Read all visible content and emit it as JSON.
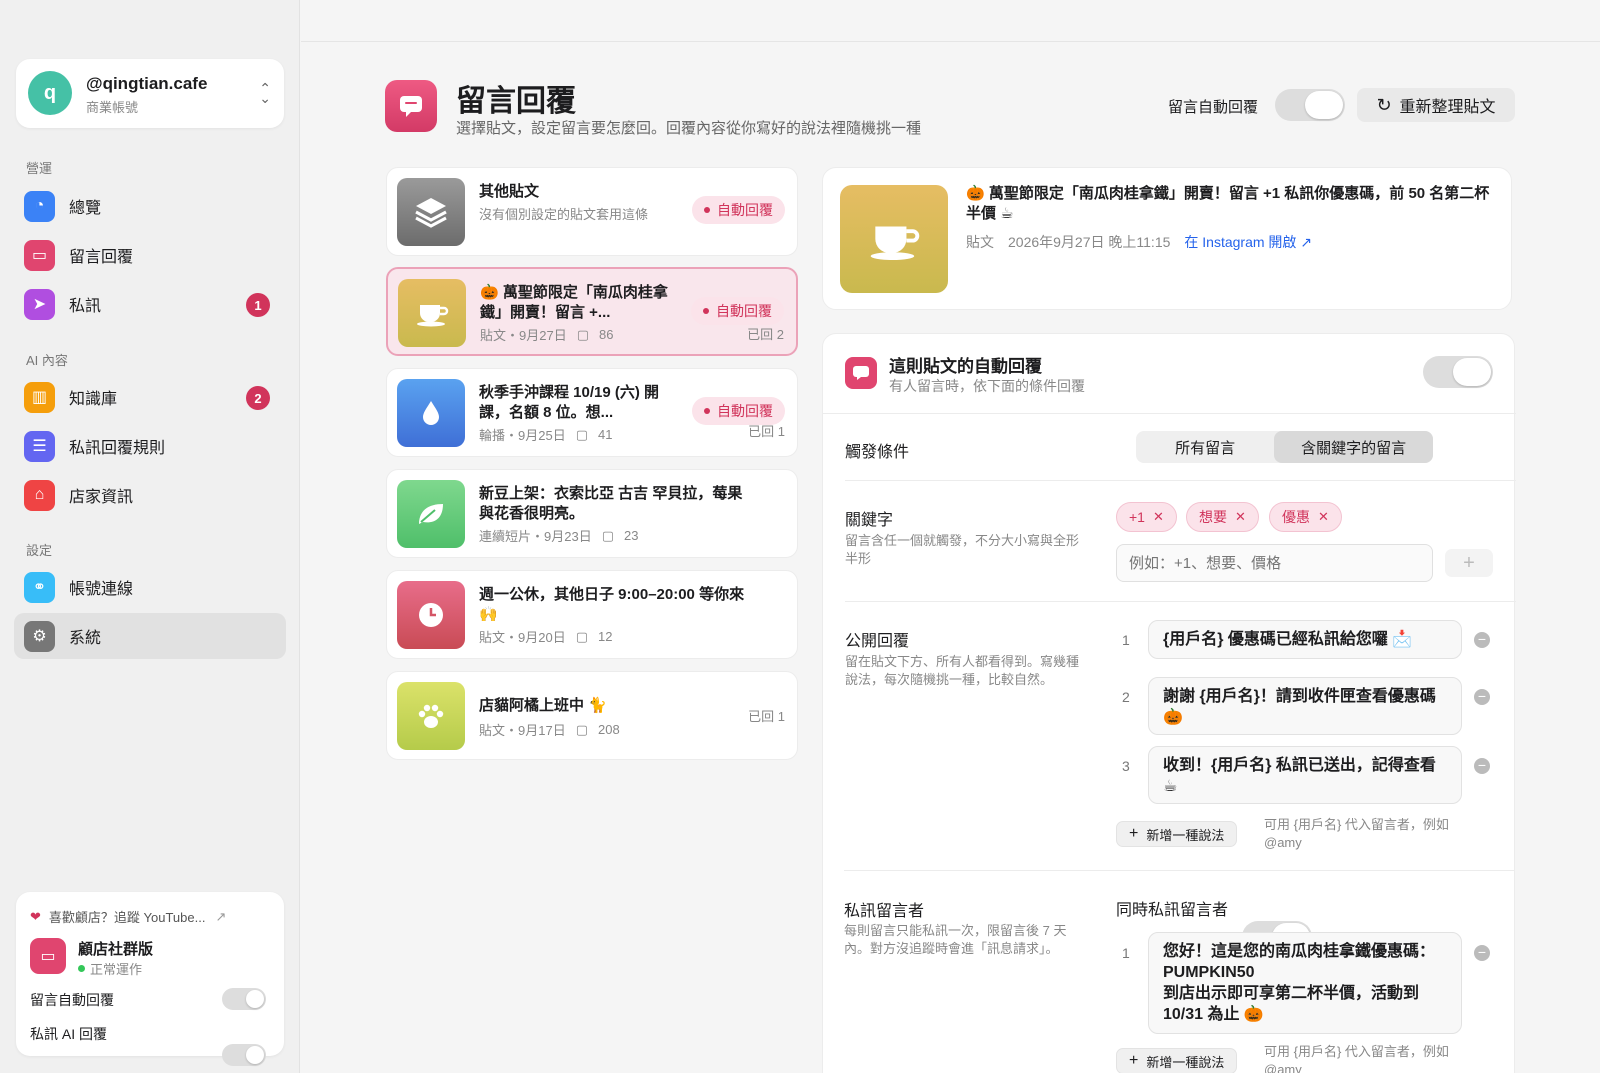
{
  "account": {
    "avatar_letter": "q",
    "handle": "@qingtian.cafe",
    "type": "商業帳號"
  },
  "sidebar": {
    "sections": [
      "營運",
      "AI 內容",
      "設定"
    ],
    "items": [
      {
        "label": "總覽",
        "icon": "dashboard-icon",
        "color": "#3b82f6"
      },
      {
        "label": "留言回覆",
        "icon": "comment-icon",
        "color": "#e0456f"
      },
      {
        "label": "私訊",
        "icon": "send-icon",
        "color": "#b04ee0",
        "badge": "1"
      },
      {
        "label": "知識庫",
        "icon": "library-icon",
        "color": "#f59e0b",
        "badge": "2"
      },
      {
        "label": "私訊回覆規則",
        "icon": "sliders-icon",
        "color": "#6366f1"
      },
      {
        "label": "店家資訊",
        "icon": "store-icon",
        "color": "#ef4444"
      },
      {
        "label": "帳號連線",
        "icon": "link-icon",
        "color": "#38bdf8"
      },
      {
        "label": "系統",
        "icon": "gear-icon",
        "color": "#777777"
      }
    ]
  },
  "promo": {
    "link": "喜歡顧店？追蹤 YouTube...",
    "app_name": "顧店社群版",
    "status": "正常運作",
    "toggle1": "留言自動回覆",
    "toggle2": "私訊 AI 回覆"
  },
  "header": {
    "title": "留言回覆",
    "subtitle": "選擇貼文，設定留言要怎麼回。回覆內容從你寫好的說法裡隨機挑一種",
    "auto_label": "留言自動回覆",
    "refresh_label": "重新整理貼文"
  },
  "posts": [
    {
      "title": "其他貼文",
      "desc": "沒有個別設定的貼文套用這條",
      "pill": "自動回覆"
    },
    {
      "title": "🎃 萬聖節限定「南瓜肉桂拿鐵」開賣！留言 +...",
      "meta": "貼文・9月27日",
      "count": "86",
      "pill": "自動回覆",
      "replied": "已回 2"
    },
    {
      "title": "秋季手沖課程 10/19 (六) 開課，名額 8 位。想...",
      "meta": "輪播・9月25日",
      "count": "41",
      "pill": "自動回覆",
      "replied": "已回 1"
    },
    {
      "title": "新豆上架：衣索比亞 古吉 罕貝拉，莓果與花香很明亮。",
      "meta": "連續短片・9月23日",
      "count": "23"
    },
    {
      "title": "週一公休，其他日子 9:00–20:00 等你來 🙌",
      "meta": "貼文・9月20日",
      "count": "12"
    },
    {
      "title": "店貓阿橘上班中 🐈",
      "meta": "貼文・9月17日",
      "count": "208",
      "replied": "已回 1"
    }
  ],
  "detail": {
    "title": "🎃 萬聖節限定「南瓜肉桂拿鐵」開賣！留言 +1 私訊你優惠碼，前 50 名第二杯半價 ☕",
    "type": "貼文",
    "date": "2026年9月27日 晚上11:15",
    "link": "在 Instagram 開啟 ↗"
  },
  "rule": {
    "title": "這則貼文的自動回覆",
    "subtitle": "有人留言時，依下面的條件回覆",
    "trigger_label": "觸發條件",
    "seg_all": "所有留言",
    "seg_kw": "含關鍵字的留言",
    "kw_label": "關鍵字",
    "kw_hint": "留言含任一個就觸發，不分大小寫與全形半形",
    "keywords": [
      "+1",
      "想要",
      "優惠"
    ],
    "kw_placeholder": "例如：+1、想要、價格",
    "pub_label": "公開回覆",
    "pub_hint": "留在貼文下方、所有人都看得到。寫幾種說法，每次隨機挑一種，比較自然。",
    "replies": [
      "{用戶名} 優惠碼已經私訊給您囉 📩",
      "謝謝 {用戶名}！請到收件匣查看優惠碼 🎃",
      "收到！{用戶名} 私訊已送出，記得查看 ☕"
    ],
    "add_label": "新增一種說法",
    "add_hint": "可用 {用戶名} 代入留言者，例如 @amy",
    "dm_label": "私訊留言者",
    "dm_hint": "每則留言只能私訊一次，限留言後 7 天內。對方沒追蹤時會進「訊息請求」。",
    "dm_toggle_label": "同時私訊留言者",
    "dm_reply": "您好！這是您的南瓜肉桂拿鐵優惠碼：PUMPKIN50\n到店出示即可享第二杯半價，活動到 10/31 為止 🎃"
  }
}
